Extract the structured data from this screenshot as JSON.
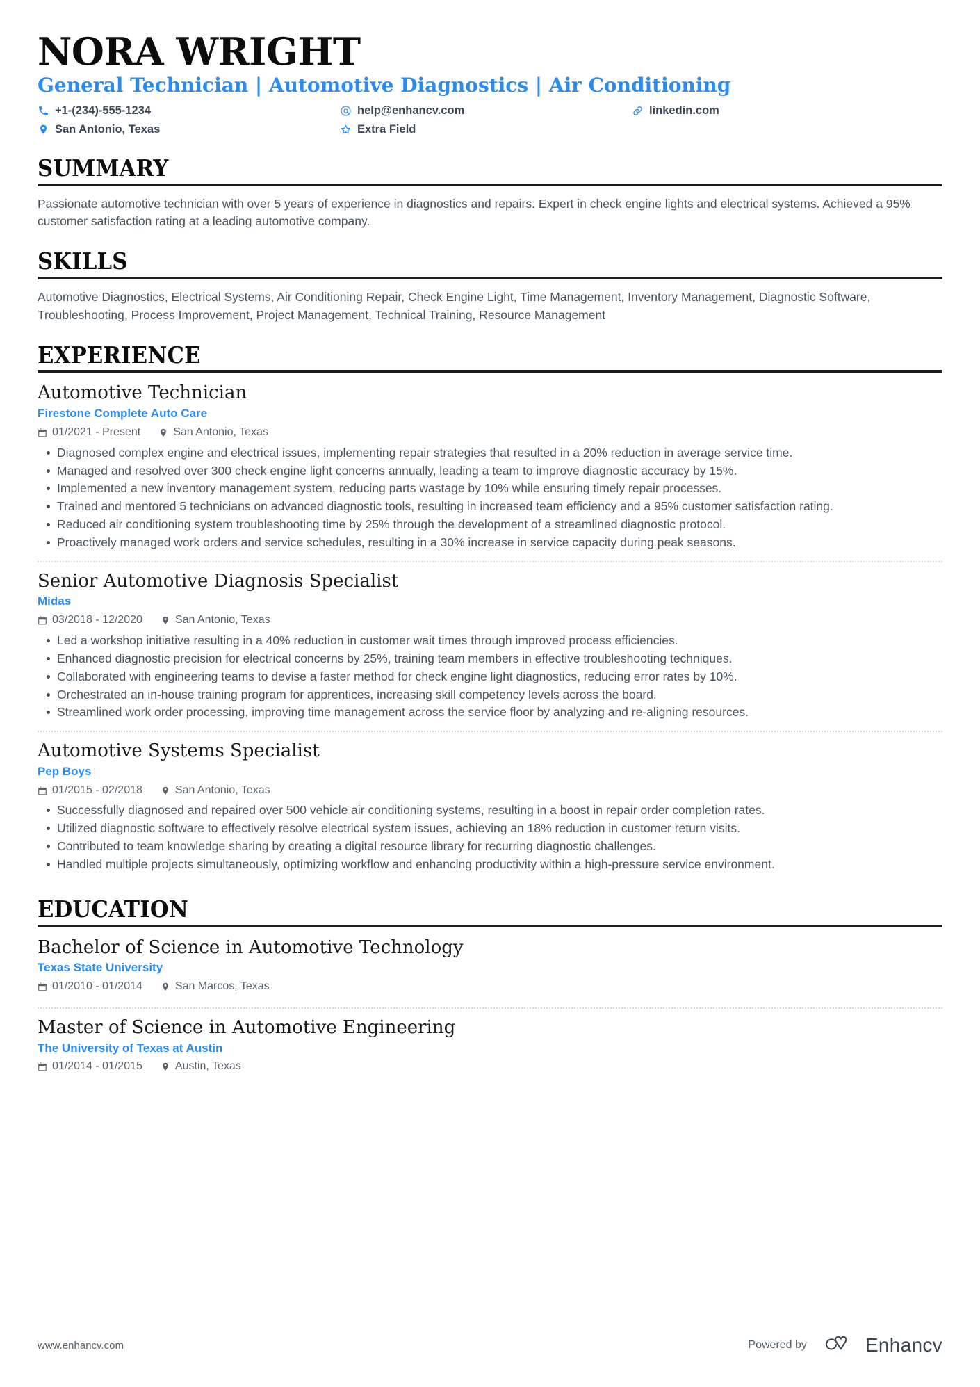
{
  "document_title": "NORA WRIGHT - Resume",
  "header": {
    "name": "NORA WRIGHT",
    "headline": "General Technician | Automotive Diagnostics | Air Conditioning",
    "contacts": [
      {
        "icon": "phone-icon",
        "text": "+1-(234)-555-1234"
      },
      {
        "icon": "email-icon",
        "text": "help@enhancv.com"
      },
      {
        "icon": "link-icon",
        "text": "linkedin.com"
      },
      {
        "icon": "location-icon",
        "text": "San Antonio, Texas"
      },
      {
        "icon": "star-icon",
        "text": "Extra Field"
      }
    ]
  },
  "sections": {
    "summary": {
      "title": "SUMMARY",
      "text": "Passionate automotive technician with over 5 years of experience in diagnostics and repairs. Expert in check engine lights and electrical systems. Achieved a 95% customer satisfaction rating at a leading automotive company."
    },
    "skills": {
      "title": "SKILLS",
      "text": "Automotive Diagnostics, Electrical Systems, Air Conditioning Repair, Check Engine Light, Time Management, Inventory Management, Diagnostic Software, Troubleshooting, Process Improvement, Project Management, Technical Training, Resource Management"
    },
    "experience": {
      "title": "EXPERIENCE",
      "entries": [
        {
          "title": "Automotive Technician",
          "organization": "Firestone Complete Auto Care",
          "dates": "01/2021 - Present",
          "location": "San Antonio, Texas",
          "bullets": [
            "Diagnosed complex engine and electrical issues, implementing repair strategies that resulted in a 20% reduction in average service time.",
            "Managed and resolved over 300 check engine light concerns annually, leading a team to improve diagnostic accuracy by 15%.",
            "Implemented a new inventory management system, reducing parts wastage by 10% while ensuring timely repair processes.",
            "Trained and mentored 5 technicians on advanced diagnostic tools, resulting in increased team efficiency and a 95% customer satisfaction rating.",
            "Reduced air conditioning system troubleshooting time by 25% through the development of a streamlined diagnostic protocol.",
            "Proactively managed work orders and service schedules, resulting in a 30% increase in service capacity during peak seasons."
          ]
        },
        {
          "title": "Senior Automotive Diagnosis Specialist",
          "organization": "Midas",
          "dates": "03/2018 - 12/2020",
          "location": "San Antonio, Texas",
          "bullets": [
            "Led a workshop initiative resulting in a 40% reduction in customer wait times through improved process efficiencies.",
            "Enhanced diagnostic precision for electrical concerns by 25%, training team members in effective troubleshooting techniques.",
            "Collaborated with engineering teams to devise a faster method for check engine light diagnostics, reducing error rates by 10%.",
            "Orchestrated an in-house training program for apprentices, increasing skill competency levels across the board.",
            "Streamlined work order processing, improving time management across the service floor by analyzing and re-aligning resources."
          ]
        },
        {
          "title": "Automotive Systems Specialist",
          "organization": "Pep Boys",
          "dates": "01/2015 - 02/2018",
          "location": "San Antonio, Texas",
          "bullets": [
            "Successfully diagnosed and repaired over 500 vehicle air conditioning systems, resulting in a boost in repair order completion rates.",
            "Utilized diagnostic software to effectively resolve electrical system issues, achieving an 18% reduction in customer return visits.",
            "Contributed to team knowledge sharing by creating a digital resource library for recurring diagnostic challenges.",
            "Handled multiple projects simultaneously, optimizing workflow and enhancing productivity within a high-pressure service environment."
          ]
        }
      ]
    },
    "education": {
      "title": "EDUCATION",
      "entries": [
        {
          "title": "Bachelor of Science in Automotive Technology",
          "organization": "Texas State University",
          "dates": "01/2010 - 01/2014",
          "location": "San Marcos, Texas"
        },
        {
          "title": "Master of Science in Automotive Engineering",
          "organization": "The University of Texas at Austin",
          "dates": "01/2014 - 01/2015",
          "location": "Austin, Texas"
        }
      ]
    }
  },
  "footer": {
    "url": "www.enhancv.com",
    "powered_by": "Powered by",
    "brand": "Enhancv"
  },
  "colors": {
    "accent_blue": "#2a8bf2",
    "heading_black": "#0d0d0d",
    "body_gray": "#4a5560",
    "meta_gray": "#59636e",
    "divider": "#d5dbe0"
  }
}
